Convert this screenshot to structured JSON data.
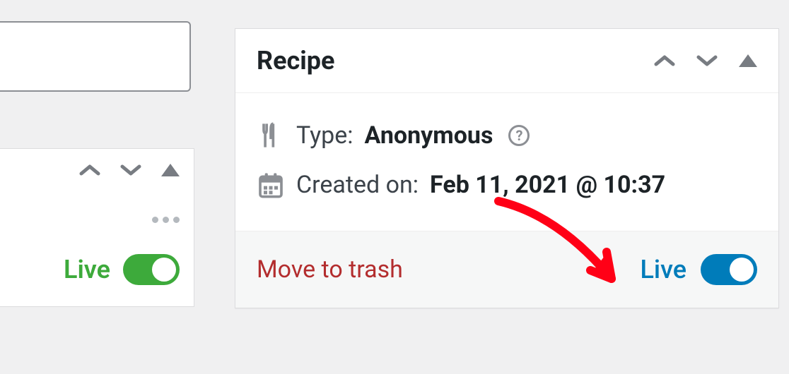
{
  "recipe": {
    "title": "Recipe",
    "type_label": "Type:",
    "type_value": "Anonymous",
    "created_label": "Created on:",
    "created_value": "Feb 11, 2021 @ 10:37",
    "trash_label": "Move to trash",
    "live_label": "Live"
  },
  "side": {
    "live_label": "Live"
  }
}
